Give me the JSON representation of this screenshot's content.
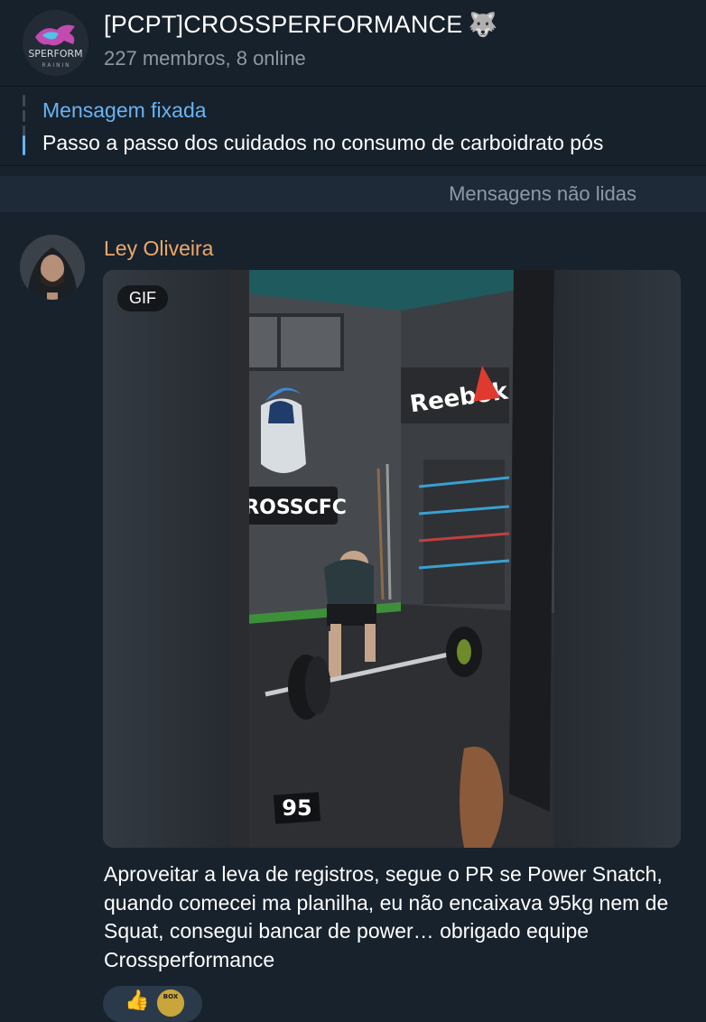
{
  "header": {
    "title": "[PCPT]CROSSPERFORMANCE",
    "title_emoji": "🐺",
    "subtitle": "227 membros, 8 online",
    "avatar_text": "SPERFORM",
    "avatar_subtext": "R A I N I N"
  },
  "pinned": {
    "title": "Mensagem fixada",
    "text": "Passo a passo dos cuidados no consumo de carboidrato pós"
  },
  "unread_divider": "Mensagens não lidas",
  "message": {
    "sender": "Ley Oliveira",
    "media": {
      "badge": "GIF",
      "wall_brand": "Reebok",
      "wall_logo_text": "CROSSCFC",
      "overlay_number": "95"
    },
    "caption": "Aproveitar a leva de registros, segue o PR se Power Snatch, quando comecei ma planilha, eu não encaixava 95kg nem de Squat, consegui bancar de power… obrigado equipe Crossperformance",
    "reaction": {
      "emoji": "👍",
      "avatar_text": "BOX"
    }
  },
  "colors": {
    "background": "#18222d",
    "header_bg": "#17212b",
    "accent_blue": "#6ab3f3",
    "sender_name": "#eea86a",
    "muted_text": "#8c99a6"
  }
}
